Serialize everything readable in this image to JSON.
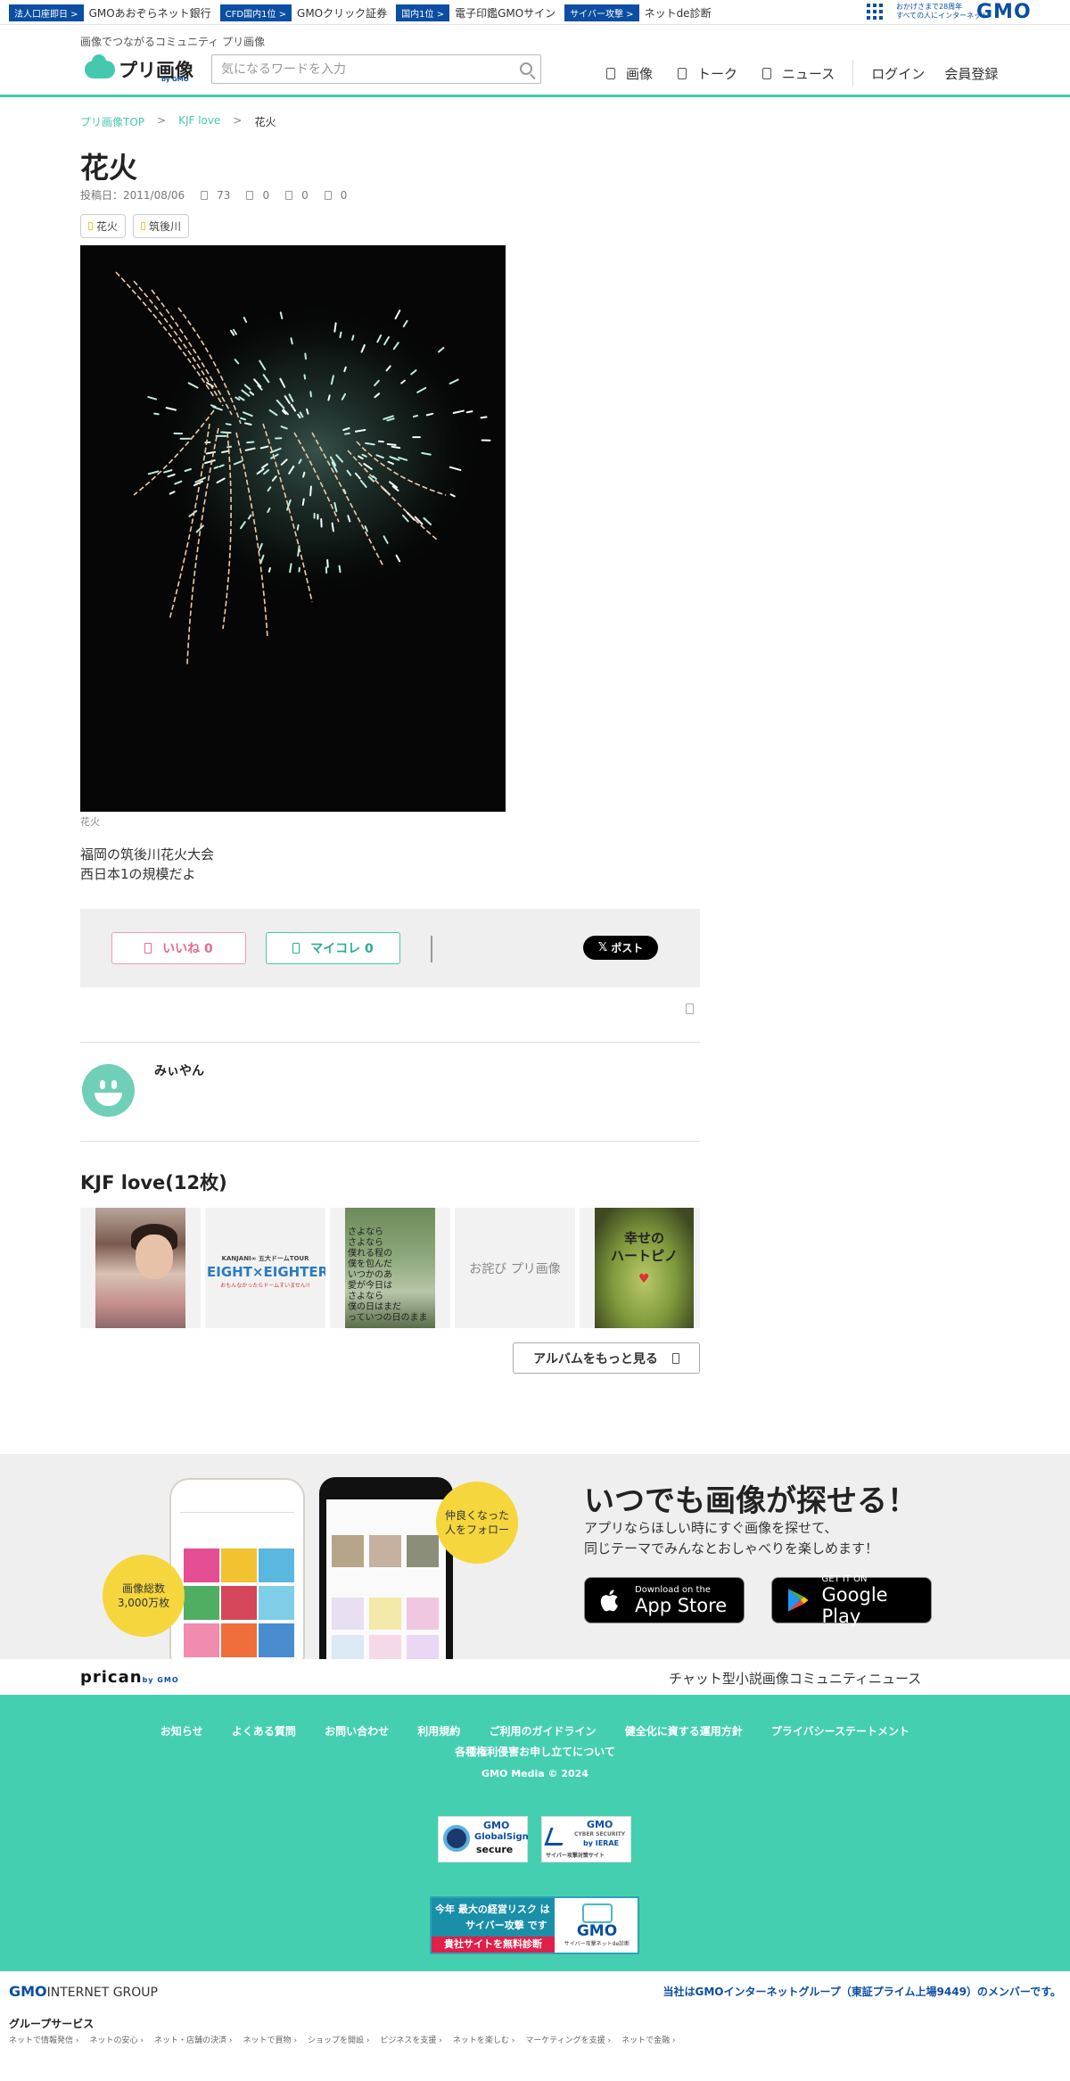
{
  "gmo_bar": {
    "items": [
      {
        "badge": "法人口座即日",
        "text": "GMOあおぞらネット銀行"
      },
      {
        "badge": "CFD国内1位",
        "text": "GMOクリック証券"
      },
      {
        "badge": "国内1位",
        "text": "電子印鑑GMOサイン"
      },
      {
        "badge": "サイバー攻撃",
        "text": "ネットde診断"
      }
    ],
    "tagline_1": "おかげさまで28周年",
    "tagline_2": "すべての人にインターネット",
    "logo": "GMO"
  },
  "header": {
    "tagline": "画像でつながるコミュニティ プリ画像",
    "logo_text": "プリ画像",
    "logo_by": "by GMO",
    "search_placeholder": "気になるワードを入力",
    "nav": [
      "画像",
      "トーク",
      "ニュース"
    ],
    "login": "ログイン",
    "signup": "会員登録"
  },
  "breadcrumb": [
    {
      "label": "プリ画像TOP"
    },
    {
      "label": "KJF love"
    },
    {
      "label": "花火"
    }
  ],
  "breadcrumb_sep": ">",
  "post": {
    "title": "花火",
    "date": "投稿日：2011/08/06",
    "stats": [
      "73",
      "0",
      "0",
      "0"
    ],
    "tags": [
      "花火",
      "筑後川"
    ],
    "caption": "花火",
    "description_1": "福岡の筑後川花火大会",
    "description_2": "西日本1の規模だよ"
  },
  "actions": {
    "like": "いいね 0",
    "collect": "マイコレ 0",
    "post": "ポスト",
    "post_x": "𝕏"
  },
  "user": {
    "name": "みぃやん"
  },
  "album": {
    "title": "KJF love(12枚)",
    "thumb2_line1": "KANJANI∞ 五大ドームTOUR",
    "thumb2_line2": "EIGHT×EIGHTER",
    "thumb2_line3": "おもんなかったらドームすいません!!",
    "thumb3_text": "さよなら\nさよなら\n僕れる程の\n僕を包んだ\nいつかのあ\n愛が今日は\nさよなら\n僕の日はまだ\nっていつの日のまま",
    "thumb4_alt": "お詫び プリ画像",
    "thumb5_text_1": "幸せの",
    "thumb5_text_2": "ハートピノ",
    "more": "アルバムをもっと見る"
  },
  "promo": {
    "bubble_left_1": "画像総数",
    "bubble_left_2": "3,000万枚",
    "bubble_right_1": "仲良くなった",
    "bubble_right_2": "人をフォロー",
    "title": "いつでも画像が探せる！",
    "sub_1": "アプリならほしい時にすぐ画像を探せて、",
    "sub_2": "同じテーマでみんなとおしゃべりを楽しめます！",
    "apple_small": "Download on the",
    "apple_big": "App Store",
    "google_small": "GET IT ON",
    "google_big": "Google Play"
  },
  "subnav": {
    "brand": "prican",
    "brand_by": "by GMO",
    "links": [
      "チャット型小説",
      "画像コミュニティ",
      "ニュース"
    ]
  },
  "footer": {
    "links_row1": [
      "お知らせ",
      "よくある質問",
      "お問い合わせ",
      "利用規約",
      "ご利用のガイドライン",
      "健全化に資する運用方針",
      "プライバシーステートメント"
    ],
    "links_row2": [
      "各種権利侵害お申し立てについて"
    ],
    "copyright": "GMO Media © 2024",
    "seal_gs_1": "GMO",
    "seal_gs_2": "GlobalSign",
    "seal_gs_3": "secure",
    "seal_ierae_1": "GMO",
    "seal_ierae_2": "CYBER SECURITY",
    "seal_ierae_3": "by IERAE",
    "seal_ierae_4": "サイバー攻撃対策サイト",
    "ad_top": "今年 最大の経営リスク は",
    "ad_mid": "サイバー攻撃 です",
    "ad_bottom": "貴社サイトを無料診断",
    "ad_logo": "GMO",
    "ad_logo_sub": "サイバー攻撃ネットde診断"
  },
  "group": {
    "logo_gmo": "GMO",
    "logo_rest": "INTERNET GROUP",
    "member": "当社はGMOインターネットグループ（東証プライム上場9449）のメンバーです。",
    "services": "グループサービス",
    "categories": [
      "ネットで情報発信",
      "ネットの安心",
      "ネット・店舗の決済",
      "ネットで買物",
      "ショップを開設",
      "ビジネスを支援",
      "ネットを楽しむ",
      "マーケティングを支援",
      "ネットで金融"
    ]
  },
  "colors": {
    "accent": "#45c9ae",
    "gmo_blue": "#0b4ea2",
    "like_pink": "#e86b8f"
  }
}
